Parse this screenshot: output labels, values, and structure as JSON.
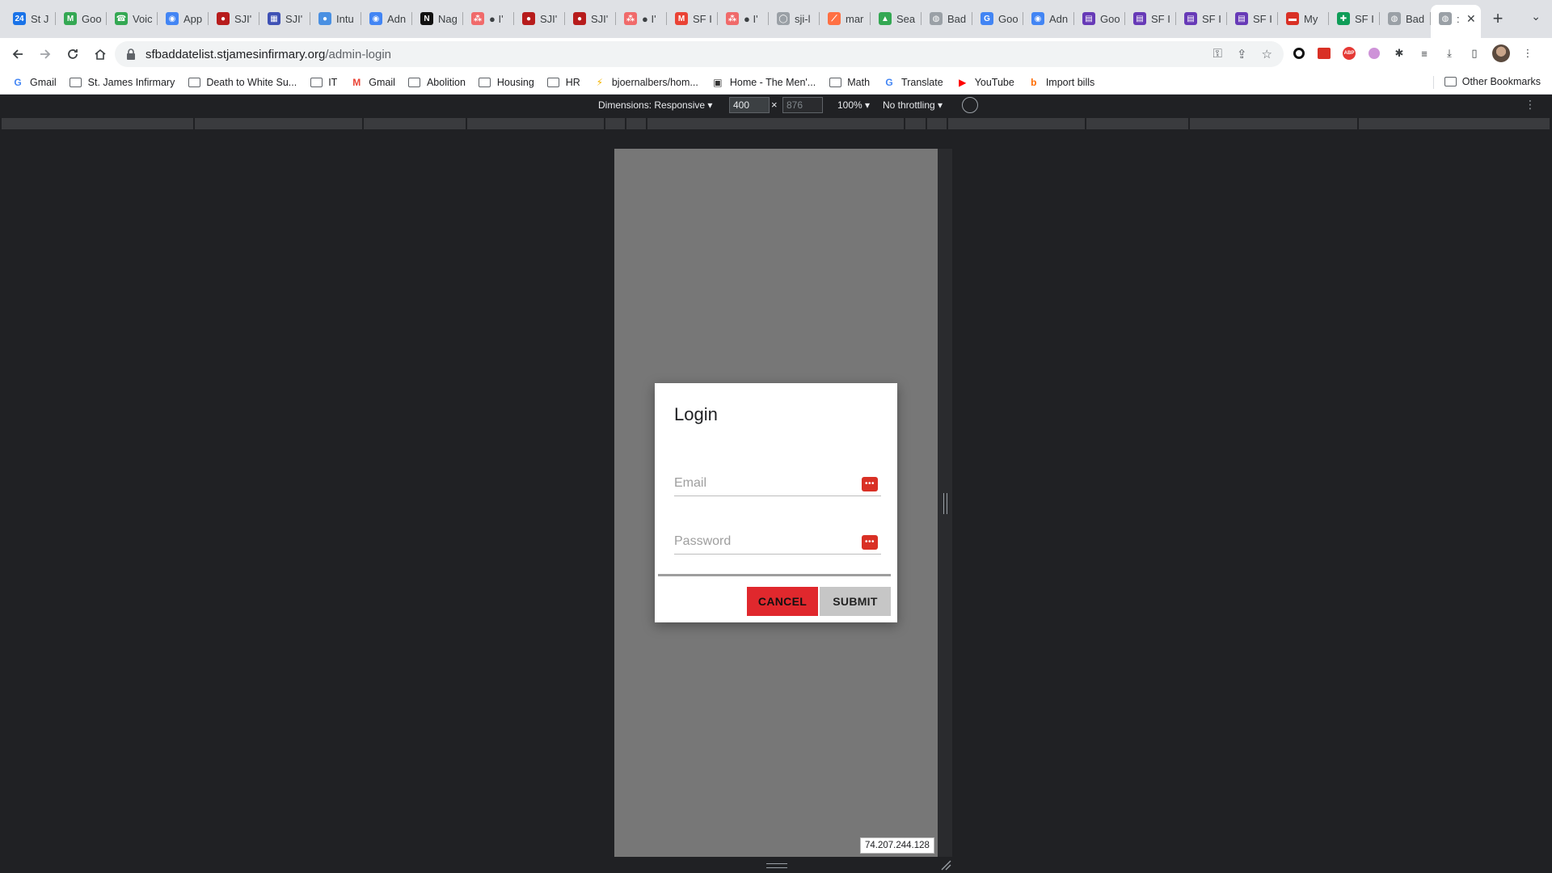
{
  "tabs": [
    {
      "title": "St J",
      "color": "#1a73e8",
      "glyph": "24"
    },
    {
      "title": "Goo",
      "color": "#34a853",
      "glyph": "M"
    },
    {
      "title": "Voic",
      "color": "#34a853",
      "glyph": "☎"
    },
    {
      "title": "App",
      "color": "#4285f4",
      "glyph": "◉"
    },
    {
      "title": "SJI'",
      "color": "#b71c1c",
      "glyph": "●"
    },
    {
      "title": "SJI'",
      "color": "#3f51b5",
      "glyph": "▦"
    },
    {
      "title": "Intu",
      "color": "#4a90e2",
      "glyph": "●"
    },
    {
      "title": "Adn",
      "color": "#4285f4",
      "glyph": "◉"
    },
    {
      "title": "Nag",
      "color": "#111111",
      "glyph": "N"
    },
    {
      "title": "● I'",
      "color": "#f06a6a",
      "glyph": "⁂"
    },
    {
      "title": "SJI'",
      "color": "#b71c1c",
      "glyph": "●"
    },
    {
      "title": "SJI'",
      "color": "#b71c1c",
      "glyph": "●"
    },
    {
      "title": "● I'",
      "color": "#f06a6a",
      "glyph": "⁂"
    },
    {
      "title": "SF I",
      "color": "#ea4335",
      "glyph": "M"
    },
    {
      "title": "● I'",
      "color": "#f06a6a",
      "glyph": "⁂"
    },
    {
      "title": "sji-l",
      "color": "#9aa0a6",
      "glyph": "◯"
    },
    {
      "title": "mar",
      "color": "#ff7043",
      "glyph": "⟋"
    },
    {
      "title": "Sea",
      "color": "#34a853",
      "glyph": "▲"
    },
    {
      "title": "Bad",
      "color": "#9aa0a6",
      "glyph": "◍"
    },
    {
      "title": "Goo",
      "color": "#4285f4",
      "glyph": "G"
    },
    {
      "title": "Adn",
      "color": "#4285f4",
      "glyph": "◉"
    },
    {
      "title": "Goo",
      "color": "#673ab7",
      "glyph": "▤"
    },
    {
      "title": "SF I",
      "color": "#673ab7",
      "glyph": "▤"
    },
    {
      "title": "SF I",
      "color": "#673ab7",
      "glyph": "▤"
    },
    {
      "title": "SF I",
      "color": "#673ab7",
      "glyph": "▤"
    },
    {
      "title": "My",
      "color": "#d93025",
      "glyph": "▬"
    },
    {
      "title": "SF I",
      "color": "#0f9d58",
      "glyph": "✚"
    },
    {
      "title": "Bad",
      "color": "#9aa0a6",
      "glyph": "◍"
    }
  ],
  "active_tab": {
    "title": ":",
    "color": "#9aa0a6",
    "glyph": "◍"
  },
  "url": {
    "host": "sfbaddatelist.stjamesinfirmary.org",
    "path": "/admin-login"
  },
  "bookmarks": [
    {
      "label": "Gmail",
      "type": "icon",
      "glyph": "G",
      "color": "#4285f4"
    },
    {
      "label": "St. James Infirmary",
      "type": "folder"
    },
    {
      "label": "Death to White Su...",
      "type": "folder"
    },
    {
      "label": "IT",
      "type": "folder"
    },
    {
      "label": "Gmail",
      "type": "icon",
      "glyph": "M",
      "color": "#ea4335"
    },
    {
      "label": "Abolition",
      "type": "folder"
    },
    {
      "label": "Housing",
      "type": "folder"
    },
    {
      "label": "HR",
      "type": "folder"
    },
    {
      "label": "bjoernalbers/hom...",
      "type": "icon",
      "glyph": "⚡",
      "color": "#f4b400"
    },
    {
      "label": "Home - The Men'...",
      "type": "icon",
      "glyph": "▣",
      "color": "#333333"
    },
    {
      "label": "Math",
      "type": "folder"
    },
    {
      "label": "Translate",
      "type": "icon",
      "glyph": "G",
      "color": "#4285f4"
    },
    {
      "label": "YouTube",
      "type": "icon",
      "glyph": "▶",
      "color": "#ff0000"
    },
    {
      "label": "Import bills",
      "type": "icon",
      "glyph": "b",
      "color": "#ff6d00"
    }
  ],
  "other_bookmarks": "Other Bookmarks",
  "devtools": {
    "dimensions_label": "Dimensions: Responsive ▾",
    "width": "400",
    "times": "×",
    "height": "876",
    "zoom": "100% ▾",
    "throttling": "No throttling ▾"
  },
  "dialog": {
    "title": "Login",
    "email_placeholder": "Email",
    "password_placeholder": "Password",
    "cancel_label": "CANCEL",
    "submit_label": "SUBMIT"
  },
  "ip_address": "74.207.244.128",
  "colors": {
    "cancel": "#e0282d",
    "submit": "#c6c6c6",
    "overlay": "#777777"
  }
}
